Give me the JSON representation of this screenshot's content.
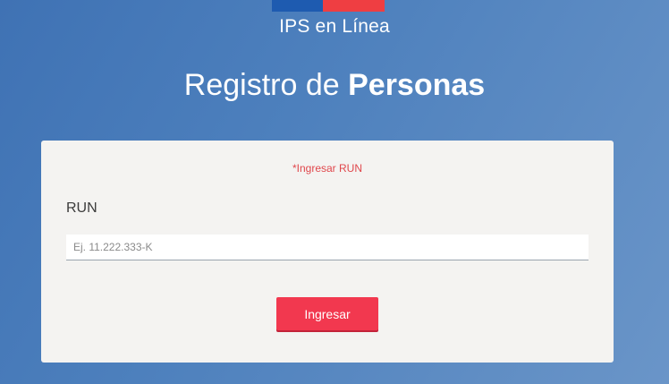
{
  "header": {
    "brand": "IPS en Línea",
    "title_regular": "Registro de ",
    "title_bold": "Personas"
  },
  "form": {
    "required_note": "*Ingresar RUN",
    "run_label": "RUN",
    "run_value": "",
    "run_placeholder": "Ej. 11.222.333-K",
    "submit_label": "Ingresar"
  },
  "colors": {
    "background": "#4d80bd",
    "flag_blue": "#1e5bb0",
    "flag_red": "#ef3e42",
    "card": "#f4f3f1",
    "required_note": "#e0474c",
    "button": "#f2384f"
  }
}
